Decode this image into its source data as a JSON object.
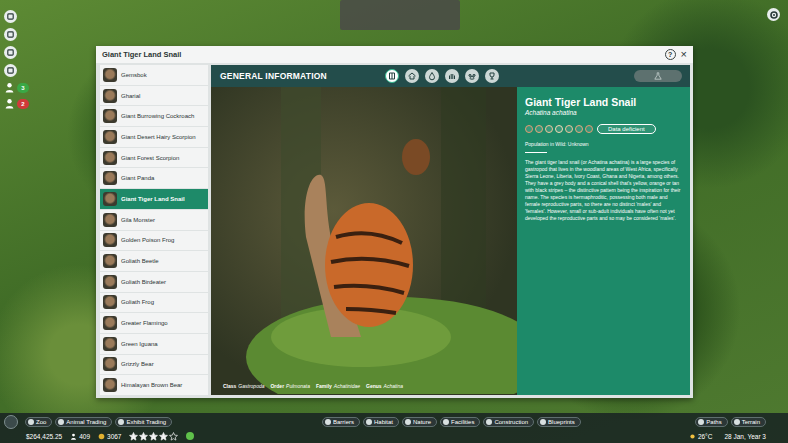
{
  "hud": {
    "alerts": [
      {
        "count": "3",
        "color": "#3aa845"
      },
      {
        "count": "2",
        "color": "#d03a3a"
      }
    ]
  },
  "window": {
    "title": "Giant Tiger Land Snail",
    "help": "?",
    "close": "×"
  },
  "animal_list": [
    {
      "name": "Gemsbok",
      "selected": false
    },
    {
      "name": "Gharial",
      "selected": false
    },
    {
      "name": "Giant Burrowing Cockroach",
      "selected": false
    },
    {
      "name": "Giant Desert Hairy Scorpion",
      "selected": false
    },
    {
      "name": "Giant Forest Scorpion",
      "selected": false
    },
    {
      "name": "Giant Panda",
      "selected": false
    },
    {
      "name": "Giant Tiger Land Snail",
      "selected": true
    },
    {
      "name": "Gila Monster",
      "selected": false
    },
    {
      "name": "Golden Poison Frog",
      "selected": false
    },
    {
      "name": "Goliath Beetle",
      "selected": false
    },
    {
      "name": "Goliath Birdeater",
      "selected": false
    },
    {
      "name": "Goliath Frog",
      "selected": false
    },
    {
      "name": "Greater Flamingo",
      "selected": false
    },
    {
      "name": "Green Iguana",
      "selected": false
    },
    {
      "name": "Grizzly Bear",
      "selected": false
    },
    {
      "name": "Himalayan Brown Bear",
      "selected": false
    }
  ],
  "panel": {
    "heading": "GENERAL INFORMATION",
    "tabs": [
      {
        "selected": true
      },
      {
        "selected": false
      },
      {
        "selected": false
      },
      {
        "selected": false
      },
      {
        "selected": false
      },
      {
        "selected": false
      }
    ],
    "action_button": {
      "disabled": true
    }
  },
  "animal": {
    "name": "Giant Tiger Land Snail",
    "latin": "Achatina achatina",
    "status_scale": [
      {
        "color": "#e59a72"
      },
      {
        "color": "#e8a97f"
      },
      {
        "color": "#f0c49c"
      },
      {
        "color": "#f4d8b4"
      },
      {
        "color": "#f0c49c"
      },
      {
        "color": "#e8a97f"
      },
      {
        "color": "#e59a72"
      }
    ],
    "status": "Data deficient",
    "population": "Population in Wild: Unknown",
    "description": "The giant tiger land snail (or Achatina achatina) is a large species of gastropod that lives in the woodland areas of West Africa, specifically Sierra Leone, Liberia, Ivory Coast, Ghana and Nigeria, among others. They have a grey body and a conical shell that's yellow, orange or tan with black stripes – the distinctive pattern being the inspiration for their name. The species is hermaphroditic, possessing both male and female reproductive parts, so there are no distinct 'males' and 'females'. However, small or sub-adult individuals have often not yet developed the reproductive parts and so may be considered 'males'.",
    "taxonomy": [
      {
        "label": "Class",
        "value": "Gastropoda"
      },
      {
        "label": "Order",
        "value": "Pulmonata"
      },
      {
        "label": "Family",
        "value": "Achatinidae"
      },
      {
        "label": "Genus",
        "value": "Achatina"
      }
    ]
  },
  "toolbar": {
    "left": [
      "Zoo",
      "Animal Trading",
      "Exhibit Trading"
    ],
    "center": [
      "Barriers",
      "Habitat",
      "Nature",
      "Facilities",
      "Construction",
      "Blueprints"
    ],
    "right": [
      "Paths",
      "Terrain"
    ]
  },
  "status_bar": {
    "money": "$264,425.25",
    "guests": "409",
    "rating_points": "3067",
    "stars": 4,
    "temperature": "26°C",
    "date": "28 Jan, Year 3"
  }
}
